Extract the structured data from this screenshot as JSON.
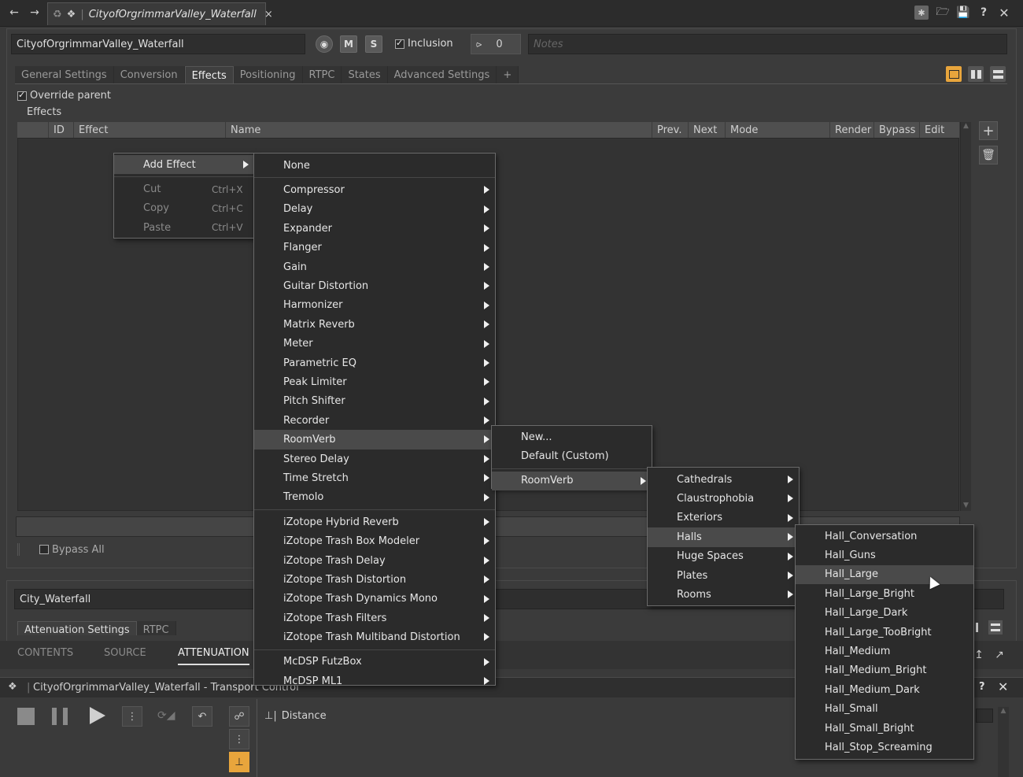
{
  "topbar": {
    "tab_title": "CityofOrgrimmarValley_Waterfall",
    "close": "×"
  },
  "object": {
    "name": "CityofOrgrimmarValley_Waterfall",
    "m_label": "M",
    "s_label": "S",
    "inclusion_label": "Inclusion",
    "share_count": "0",
    "notes_placeholder": "Notes"
  },
  "tabs": [
    "General Settings",
    "Conversion",
    "Effects",
    "Positioning",
    "RTPC",
    "States",
    "Advanced Settings",
    "+"
  ],
  "effects": {
    "override_parent": "Override parent",
    "group_label": "Effects",
    "columns": [
      "ID",
      "Effect",
      "Name",
      "Prev.",
      "Next",
      "Mode",
      "Render",
      "Bypass",
      "Edit"
    ],
    "bypass_all": "Bypass All"
  },
  "context_menu": {
    "items": [
      {
        "label": "Add Effect",
        "shortcut": ""
      },
      {
        "label": "Cut",
        "shortcut": "Ctrl+X"
      },
      {
        "label": "Copy",
        "shortcut": "Ctrl+C"
      },
      {
        "label": "Paste",
        "shortcut": "Ctrl+V"
      }
    ]
  },
  "effect_menu": {
    "none": "None",
    "group1": [
      "Compressor",
      "Delay",
      "Expander",
      "Flanger",
      "Gain",
      "Guitar Distortion",
      "Harmonizer",
      "Matrix Reverb",
      "Meter",
      "Parametric EQ",
      "Peak Limiter",
      "Pitch Shifter",
      "Recorder",
      "RoomVerb",
      "Stereo Delay",
      "Time Stretch",
      "Tremolo"
    ],
    "group2": [
      "iZotope Hybrid Reverb",
      "iZotope Trash Box Modeler",
      "iZotope Trash Delay",
      "iZotope Trash Distortion",
      "iZotope Trash Dynamics Mono",
      "iZotope Trash Filters",
      "iZotope Trash Multiband Distortion"
    ],
    "group3": [
      "McDSP FutzBox",
      "McDSP ML1"
    ]
  },
  "roomverb_menu": {
    "new": "New...",
    "default": "Default (Custom)",
    "roomverb": "RoomVerb"
  },
  "category_menu": [
    "Cathedrals",
    "Claustrophobia",
    "Exteriors",
    "Halls",
    "Huge Spaces",
    "Plates",
    "Rooms"
  ],
  "halls_menu": [
    "Hall_Conversation",
    "Hall_Guns",
    "Hall_Large",
    "Hall_Large_Bright",
    "Hall_Large_Dark",
    "Hall_Large_TooBright",
    "Hall_Medium",
    "Hall_Medium_Bright",
    "Hall_Medium_Dark",
    "Hall_Small",
    "Hall_Small_Bright",
    "Hall_Stop_Screaming"
  ],
  "lower": {
    "attenuation_name": "City_Waterfall",
    "sub_tabs": [
      "Attenuation Settings",
      "RTPC"
    ],
    "bottom_tabs": [
      "CONTENTS",
      "SOURCE",
      "ATTENUATION"
    ]
  },
  "transport": {
    "title": "CityofOrgrimmarValley_Waterfall - Transport Control",
    "distance_label": "Distance"
  },
  "colors": {
    "accent": "#e8a53c",
    "menu_bg": "#2b2b2b",
    "highlight": "#4a4a4a"
  }
}
